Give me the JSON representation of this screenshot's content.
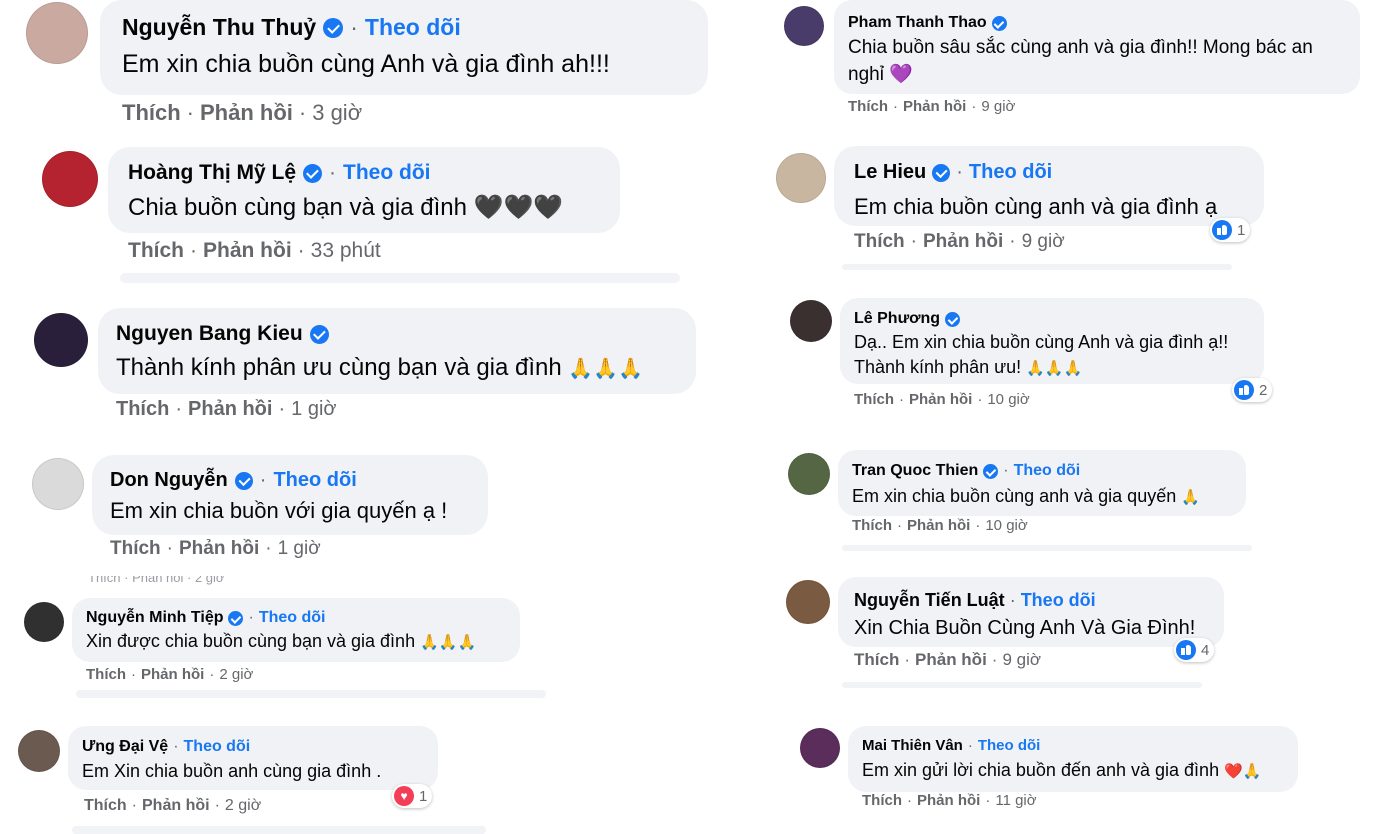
{
  "comments": [
    {
      "name": "Nguyễn Thu Thuỷ",
      "follow": "Theo dõi",
      "text": "Em xin chia buồn cùng Anh và gia đình ah!!!",
      "like": "Thích",
      "reply": "Phản hồi",
      "time": "3 giờ",
      "avatar_color": "#c9a9a0"
    },
    {
      "name": "Hoàng Thị Mỹ Lệ",
      "follow": "Theo dõi",
      "text": "Chia buồn cùng bạn và gia đình",
      "emoji": "🖤🖤🖤",
      "like": "Thích",
      "reply": "Phản hồi",
      "time": "33 phút",
      "avatar_color": "#b4232f"
    },
    {
      "name": "Nguyen Bang Kieu",
      "follow": "",
      "text": "Thành kính phân ưu cùng bạn và gia đình",
      "emoji": "🙏🙏🙏",
      "like": "Thích",
      "reply": "Phản hồi",
      "time": "1 giờ",
      "avatar_color": "#2a1f3a"
    },
    {
      "name": "Don Nguyễn",
      "follow": "Theo dõi",
      "text": "Em xin chia buồn với gia quyến ạ !",
      "like": "Thích",
      "reply": "Phản hồi",
      "time": "1 giờ",
      "avatar_color": "#dadada"
    },
    {
      "name": "Nguyễn Minh Tiệp",
      "follow": "Theo dõi",
      "text": "Xin được chia buồn cùng bạn và gia đình",
      "emoji": "🙏🙏🙏",
      "like": "Thích",
      "reply": "Phản hồi",
      "time": "2 giờ",
      "avatar_color": "#303030"
    },
    {
      "name": "Ưng Đại Vệ",
      "follow": "Theo dõi",
      "text": "Em Xin chia buồn anh cùng gia đình .",
      "like": "Thích",
      "reply": "Phản hồi",
      "time": "2 giờ",
      "reaction": "1",
      "reaction_type": "heart",
      "avatar_color": "#6b5a50"
    },
    {
      "name": "Pham Thanh Thao",
      "follow": "",
      "text": "Chia buồn sâu sắc cùng anh và gia đình!! Mong bác an",
      "text2": "nghỉ",
      "emoji": "💜",
      "like": "Thích",
      "reply": "Phản hồi",
      "time": "9 giờ",
      "avatar_color": "#4a3c6a"
    },
    {
      "name": "Le Hieu",
      "follow": "Theo dõi",
      "text": "Em chia buồn cùng anh và gia đình ạ",
      "like": "Thích",
      "reply": "Phản hồi",
      "time": "9 giờ",
      "reaction": "1",
      "reaction_type": "like",
      "avatar_color": "#c8b6a0"
    },
    {
      "name": "Lê Phương",
      "follow": "",
      "text": "Dạ.. Em xin chia buồn cùng Anh và gia đình ạ!!",
      "text2": "Thành kính phân ưu!",
      "emoji": "🙏🙏🙏",
      "like": "Thích",
      "reply": "Phản hồi",
      "time": "10 giờ",
      "reaction": "2",
      "reaction_type": "like",
      "avatar_color": "#3a3030"
    },
    {
      "name": "Tran Quoc Thien",
      "follow": "Theo dõi",
      "text": "Em xin chia buồn cùng anh và gia quyến",
      "emoji": "🙏",
      "like": "Thích",
      "reply": "Phản hồi",
      "time": "10 giờ",
      "avatar_color": "#556644"
    },
    {
      "name": "Nguyễn Tiến Luật",
      "follow": "Theo dõi",
      "text": "Xin Chia Buồn Cùng Anh Và Gia Đình!",
      "like": "Thích",
      "reply": "Phản hồi",
      "time": "9 giờ",
      "reaction": "4",
      "reaction_type": "like",
      "avatar_color": "#7a5a40"
    },
    {
      "name": "Mai Thiên Vân",
      "follow": "Theo dõi",
      "text": "Em xin gửi lời chia buồn đến anh và gia đình",
      "emoji": "❤️🙏",
      "like": "Thích",
      "reply": "Phản hồi",
      "time": "11 giờ",
      "avatar_color": "#5a2d5a"
    }
  ],
  "ghost_lines": [
    {
      "text": "Thích · Phản hồi · 2 giờ"
    }
  ],
  "colors": {
    "bubble": "#f0f2f5",
    "link": "#1877f2",
    "meta": "#65676b"
  }
}
